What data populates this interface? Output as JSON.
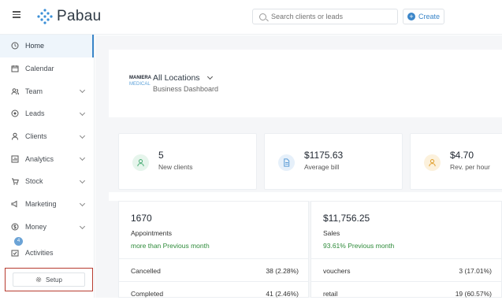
{
  "app": {
    "name": "Pabau"
  },
  "search": {
    "placeholder": "Search clients or leads"
  },
  "create": {
    "label": "Create"
  },
  "sidebar": {
    "items": [
      {
        "label": "Home",
        "icon": "home-icon",
        "active": true,
        "chevron": false
      },
      {
        "label": "Calendar",
        "icon": "calendar-icon",
        "chevron": false
      },
      {
        "label": "Team",
        "icon": "team-icon",
        "chevron": true
      },
      {
        "label": "Leads",
        "icon": "leads-icon",
        "chevron": true
      },
      {
        "label": "Clients",
        "icon": "clients-icon",
        "chevron": true
      },
      {
        "label": "Analytics",
        "icon": "analytics-icon",
        "chevron": true
      },
      {
        "label": "Stock",
        "icon": "stock-icon",
        "chevron": true
      },
      {
        "label": "Marketing",
        "icon": "marketing-icon",
        "chevron": true
      },
      {
        "label": "Money",
        "icon": "money-icon",
        "chevron": true
      },
      {
        "label": "Activities",
        "icon": "activities-icon",
        "badge": "4",
        "chevron": false
      }
    ],
    "setup_label": "Setup"
  },
  "business": {
    "logo_line1": "MANIERA",
    "logo_line2": "MEDICAL",
    "location": "All Locations",
    "subtitle": "Business Dashboard"
  },
  "stats": [
    {
      "value": "5",
      "label": "New clients",
      "icon": "new-clients-icon",
      "color": "#5fbf8a"
    },
    {
      "value": "$1175.63",
      "label": "Average bill",
      "icon": "document-icon",
      "color": "#5b9bd5"
    },
    {
      "value": "$4.70",
      "label": "Rev. per hour",
      "icon": "revenue-user-icon",
      "color": "#e6a93a"
    }
  ],
  "appointments": {
    "value": "1670",
    "label": "Appointments",
    "trend": "more than Previous month",
    "rows": [
      {
        "label": "Cancelled",
        "value": "38 (2.28%)"
      },
      {
        "label": "Completed",
        "value": "41 (2.46%)"
      }
    ]
  },
  "sales": {
    "value": "$11,756.25",
    "label": "Sales",
    "trend": "93.61% Previous month",
    "rows": [
      {
        "label": "vouchers",
        "value": "3 (17.01%)"
      },
      {
        "label": "retail",
        "value": "19 (60.57%)"
      }
    ]
  },
  "colors": {
    "accent": "#3b86c9",
    "positive": "#2e8b3a",
    "highlight_border": "#b73b2f"
  }
}
